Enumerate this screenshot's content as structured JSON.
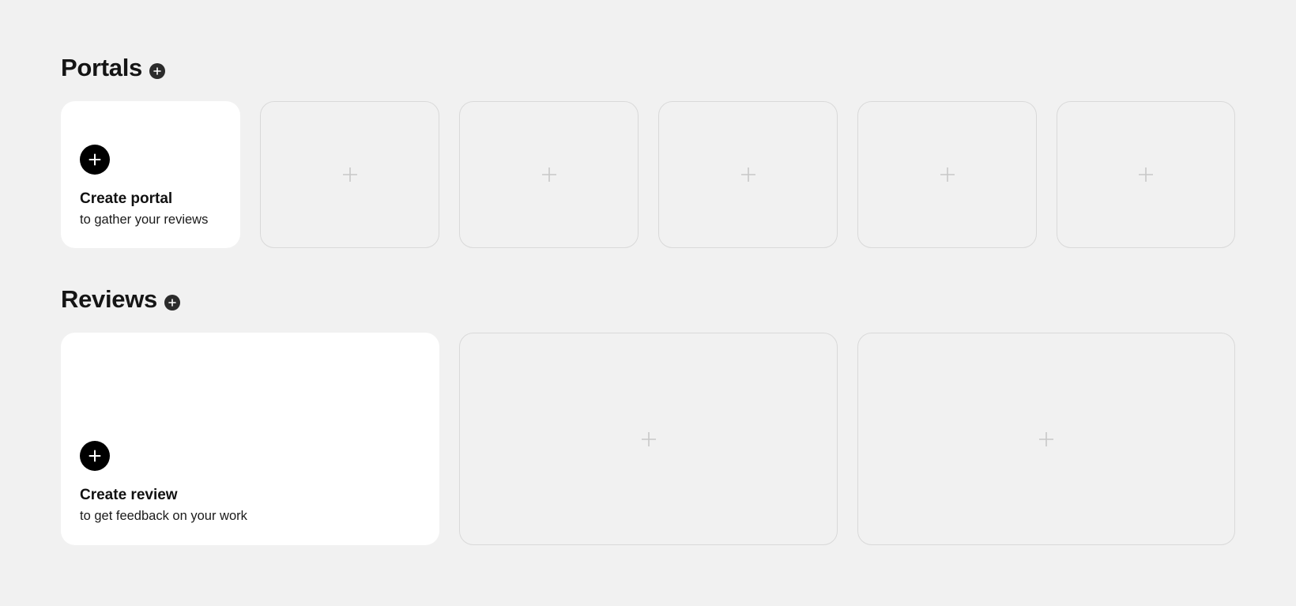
{
  "portals": {
    "title": "Portals",
    "add_icon": "plus-circle-icon",
    "create_card": {
      "title": "Create portal",
      "subtitle": "to gather your reviews",
      "icon": "plus-icon"
    },
    "placeholder_count": 5,
    "placeholder_icon": "plus-icon"
  },
  "reviews": {
    "title": "Reviews",
    "add_icon": "plus-circle-icon",
    "create_card": {
      "title": "Create review",
      "subtitle": "to get feedback on your work",
      "icon": "plus-icon"
    },
    "placeholder_count": 2,
    "placeholder_icon": "plus-icon"
  },
  "colors": {
    "background": "#f1f1f1",
    "card": "#ffffff",
    "placeholder_border": "#d9d9d9",
    "placeholder_icon": "#c8c8c8",
    "accent": "#000000"
  }
}
